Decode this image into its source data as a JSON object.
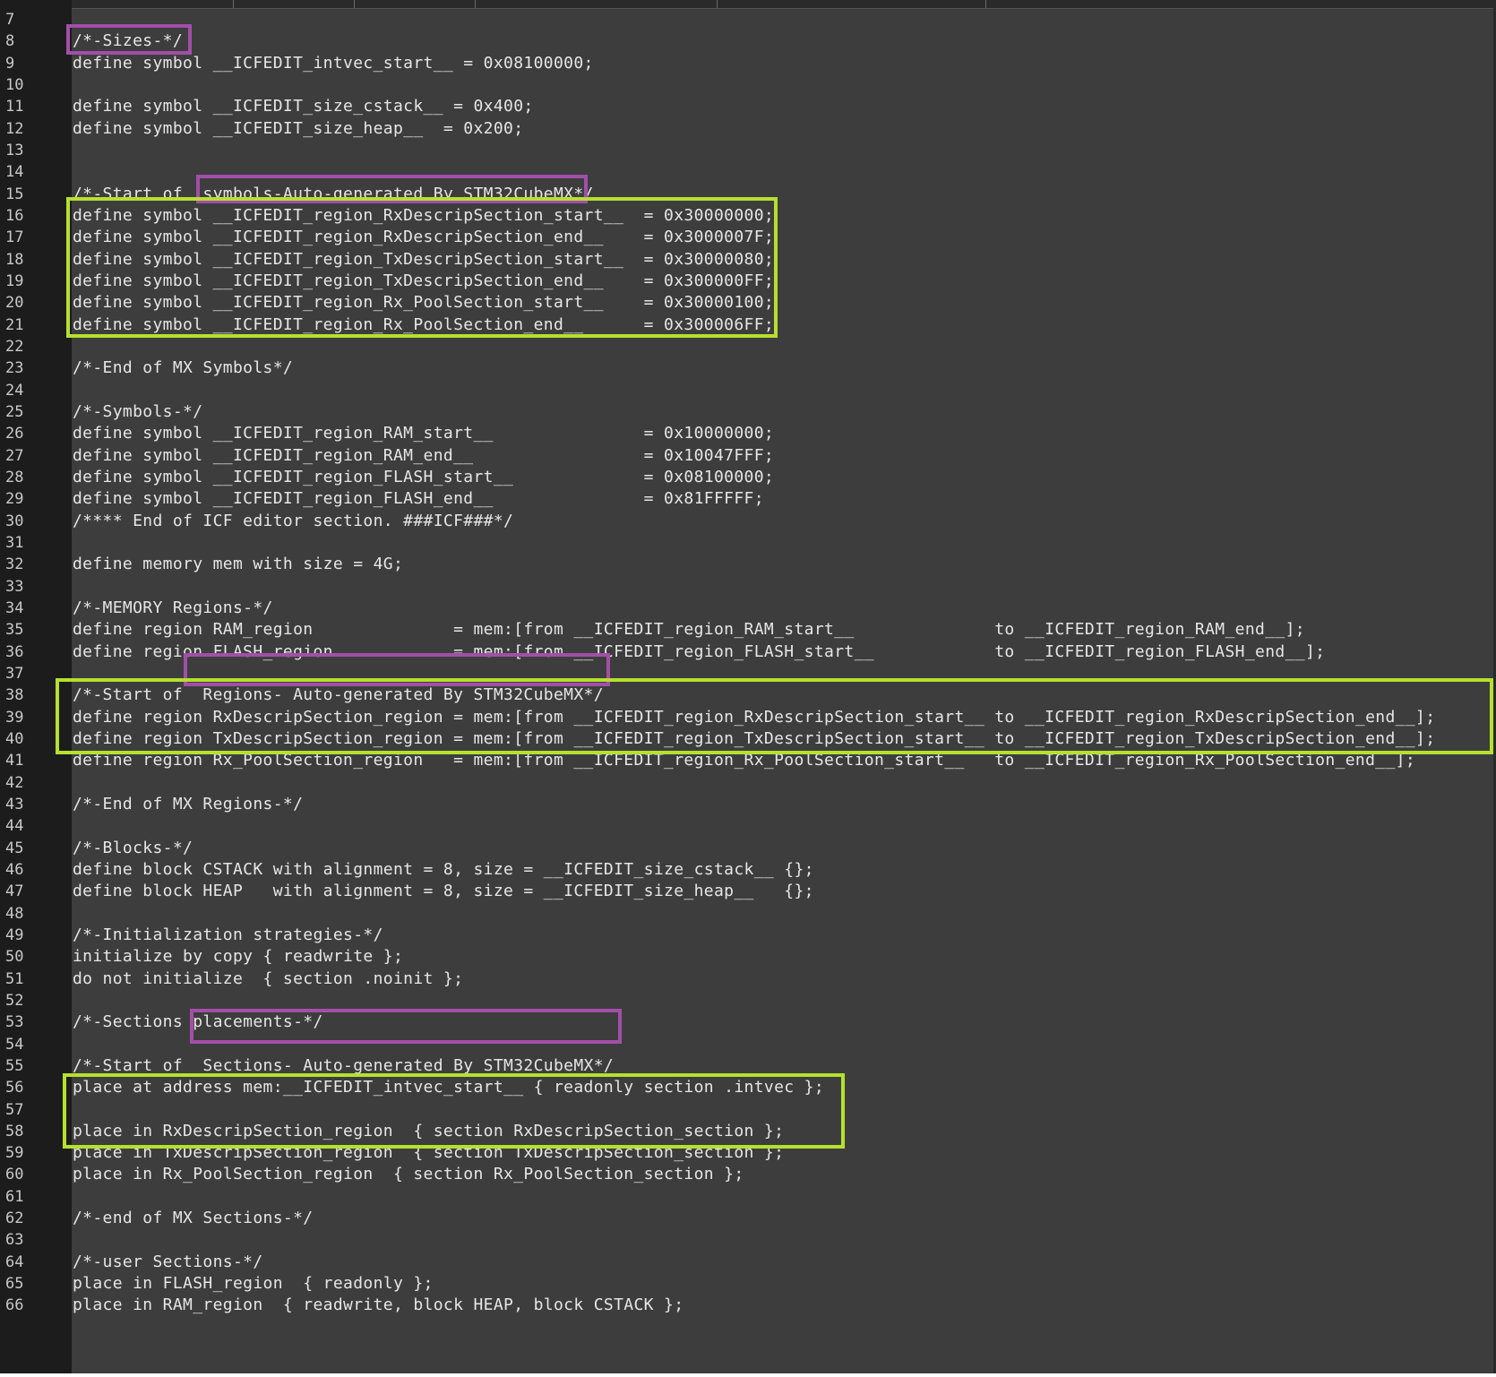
{
  "editor": {
    "lines": [
      {
        "num": "7",
        "text": ""
      },
      {
        "num": "8",
        "text": "/*-Sizes-*/"
      },
      {
        "num": "9",
        "text": "define symbol __ICFEDIT_intvec_start__ = 0x08100000;"
      },
      {
        "num": "10",
        "text": ""
      },
      {
        "num": "11",
        "text": "define symbol __ICFEDIT_size_cstack__ = 0x400;"
      },
      {
        "num": "12",
        "text": "define symbol __ICFEDIT_size_heap__  = 0x200;"
      },
      {
        "num": "13",
        "text": ""
      },
      {
        "num": "14",
        "text": ""
      },
      {
        "num": "15",
        "text": "/*-Start of  symbols-Auto-generated By STM32CubeMX*/"
      },
      {
        "num": "16",
        "text": "define symbol __ICFEDIT_region_RxDescripSection_start__  = 0x30000000;"
      },
      {
        "num": "17",
        "text": "define symbol __ICFEDIT_region_RxDescripSection_end__    = 0x3000007F;"
      },
      {
        "num": "18",
        "text": "define symbol __ICFEDIT_region_TxDescripSection_start__  = 0x30000080;"
      },
      {
        "num": "19",
        "text": "define symbol __ICFEDIT_region_TxDescripSection_end__    = 0x300000FF;"
      },
      {
        "num": "20",
        "text": "define symbol __ICFEDIT_region_Rx_PoolSection_start__    = 0x30000100;"
      },
      {
        "num": "21",
        "text": "define symbol __ICFEDIT_region_Rx_PoolSection_end__      = 0x300006FF;"
      },
      {
        "num": "22",
        "text": ""
      },
      {
        "num": "23",
        "text": "/*-End of MX Symbols*/"
      },
      {
        "num": "24",
        "text": ""
      },
      {
        "num": "25",
        "text": "/*-Symbols-*/"
      },
      {
        "num": "26",
        "text": "define symbol __ICFEDIT_region_RAM_start__               = 0x10000000;"
      },
      {
        "num": "27",
        "text": "define symbol __ICFEDIT_region_RAM_end__                 = 0x10047FFF;"
      },
      {
        "num": "28",
        "text": "define symbol __ICFEDIT_region_FLASH_start__             = 0x08100000;"
      },
      {
        "num": "29",
        "text": "define symbol __ICFEDIT_region_FLASH_end__               = 0x81FFFFF;"
      },
      {
        "num": "30",
        "text": "/**** End of ICF editor section. ###ICF###*/"
      },
      {
        "num": "31",
        "text": ""
      },
      {
        "num": "32",
        "text": "define memory mem with size = 4G;"
      },
      {
        "num": "33",
        "text": ""
      },
      {
        "num": "34",
        "text": "/*-MEMORY Regions-*/"
      },
      {
        "num": "35",
        "text": "define region RAM_region              = mem:[from __ICFEDIT_region_RAM_start__              to __ICFEDIT_region_RAM_end__];"
      },
      {
        "num": "36",
        "text": "define region FLASH_region            = mem:[from __ICFEDIT_region_FLASH_start__            to __ICFEDIT_region_FLASH_end__];"
      },
      {
        "num": "37",
        "text": ""
      },
      {
        "num": "38",
        "text": "/*-Start of  Regions- Auto-generated By STM32CubeMX*/"
      },
      {
        "num": "39",
        "text": "define region RxDescripSection_region = mem:[from __ICFEDIT_region_RxDescripSection_start__ to __ICFEDIT_region_RxDescripSection_end__];"
      },
      {
        "num": "40",
        "text": "define region TxDescripSection_region = mem:[from __ICFEDIT_region_TxDescripSection_start__ to __ICFEDIT_region_TxDescripSection_end__];"
      },
      {
        "num": "41",
        "text": "define region Rx_PoolSection_region   = mem:[from __ICFEDIT_region_Rx_PoolSection_start__   to __ICFEDIT_region_Rx_PoolSection_end__];"
      },
      {
        "num": "42",
        "text": ""
      },
      {
        "num": "43",
        "text": "/*-End of MX Regions-*/"
      },
      {
        "num": "44",
        "text": ""
      },
      {
        "num": "45",
        "text": "/*-Blocks-*/"
      },
      {
        "num": "46",
        "text": "define block CSTACK with alignment = 8, size = __ICFEDIT_size_cstack__ {};"
      },
      {
        "num": "47",
        "text": "define block HEAP   with alignment = 8, size = __ICFEDIT_size_heap__   {};"
      },
      {
        "num": "48",
        "text": ""
      },
      {
        "num": "49",
        "text": "/*-Initialization strategies-*/"
      },
      {
        "num": "50",
        "text": "initialize by copy { readwrite };"
      },
      {
        "num": "51",
        "text": "do not initialize  { section .noinit };"
      },
      {
        "num": "52",
        "text": ""
      },
      {
        "num": "53",
        "text": "/*-Sections placements-*/"
      },
      {
        "num": "54",
        "text": ""
      },
      {
        "num": "55",
        "text": "/*-Start of  Sections- Auto-generated By STM32CubeMX*/"
      },
      {
        "num": "56",
        "text": "place at address mem:__ICFEDIT_intvec_start__ { readonly section .intvec };"
      },
      {
        "num": "57",
        "text": ""
      },
      {
        "num": "58",
        "text": "place in RxDescripSection_region  { section RxDescripSection_section };"
      },
      {
        "num": "59",
        "text": "place in TxDescripSection_region  { section TxDescripSection_section };"
      },
      {
        "num": "60",
        "text": "place in Rx_PoolSection_region  { section Rx_PoolSection_section };"
      },
      {
        "num": "61",
        "text": ""
      },
      {
        "num": "62",
        "text": "/*-end of MX Sections-*/"
      },
      {
        "num": "63",
        "text": ""
      },
      {
        "num": "64",
        "text": "/*-user Sections-*/"
      },
      {
        "num": "65",
        "text": "place in FLASH_region  { readonly };"
      },
      {
        "num": "66",
        "text": "place in RAM_region  { readwrite, block HEAP, block CSTACK };"
      }
    ]
  },
  "colors": {
    "background": "#3d3d3d",
    "gutter": "#1c1c1c",
    "text": "#e6e6e6",
    "line_number": "#c8c8c8",
    "highlight_purple": "#a24fa8",
    "highlight_green": "#b6e02e"
  }
}
